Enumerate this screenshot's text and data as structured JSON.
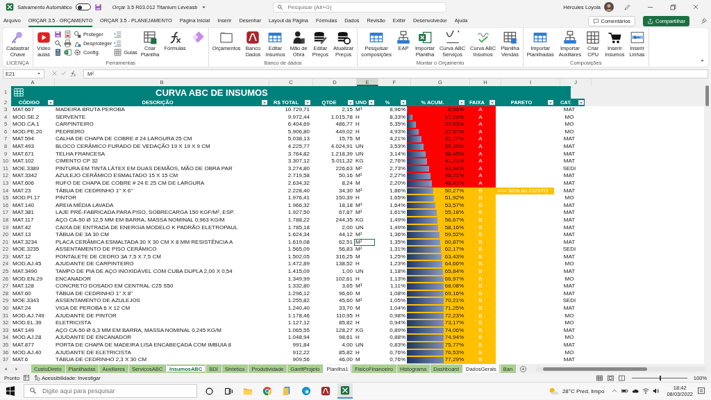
{
  "titlebar": {
    "autosave_label": "Salvamento Automático",
    "autosave": {
      "on": false
    },
    "filename": "Orçar 3.5 R03.012 Titanium Leveasb",
    "search": {
      "placeholder": "Pesquisar (Alt+G)"
    },
    "user": "Hércules Loyola"
  },
  "menu": {
    "tabs": [
      {
        "label": "Arquivo",
        "selected": false
      },
      {
        "label": "ORÇAR 3.5 - ORÇAMENTO",
        "selected": true
      },
      {
        "label": "ORÇAR 3.5 - PLANEJAMENTO",
        "selected": false
      },
      {
        "label": "Página Inicial",
        "selected": false
      },
      {
        "label": "Inserir",
        "selected": false
      },
      {
        "label": "Desenhar",
        "selected": false
      },
      {
        "label": "Layout da Página",
        "selected": false
      },
      {
        "label": "Fórmulas",
        "selected": false
      },
      {
        "label": "Dados",
        "selected": false
      },
      {
        "label": "Revisão",
        "selected": false
      },
      {
        "label": "Exibir",
        "selected": false
      },
      {
        "label": "Desenvolvedor",
        "selected": false
      },
      {
        "label": "Ajuda",
        "selected": false
      }
    ],
    "comments": "Comentários",
    "share": "Compartilhar"
  },
  "ribbon": {
    "groups": [
      {
        "label": "LICENÇA",
        "items": [
          {
            "kind": "large",
            "label": "Cadastrar\nChave"
          }
        ]
      },
      {
        "label": "Ferramentas",
        "items": [
          {
            "kind": "large",
            "label": "Vídeo\naulas"
          },
          {
            "kind": "column",
            "buttons": [
              {
                "kind": "icon"
              },
              {
                "kind": "icon"
              },
              {
                "kind": "icon"
              }
            ]
          },
          {
            "kind": "column",
            "buttons": [
              {
                "kind": "icon"
              },
              {
                "kind": "icon"
              },
              {
                "kind": "icon"
              }
            ]
          },
          {
            "kind": "column",
            "buttons": [
              {
                "kind": "small",
                "label": "Proteger"
              },
              {
                "kind": "small",
                "label": "Desproteger"
              },
              {
                "kind": "small",
                "label": "Config."
              }
            ]
          },
          {
            "kind": "column",
            "buttons": [
              {
                "kind": "icon"
              },
              {
                "kind": "icon"
              },
              {
                "kind": "small",
                "label": "Guias"
              }
            ]
          },
          {
            "kind": "large",
            "label": "Criar\nPlanilha"
          },
          {
            "kind": "large",
            "label": "Fórmulas"
          },
          {
            "kind": "large_icon"
          }
        ]
      },
      {
        "label": "Banco de dados",
        "items": [
          {
            "kind": "large",
            "label": "Orçamentos"
          },
          {
            "kind": "large",
            "label": "Banco\nDados"
          },
          {
            "kind": "large",
            "label": "Editar\nInsumos"
          },
          {
            "kind": "large",
            "label": "Mão de\nObra"
          },
          {
            "kind": "large",
            "label": "Editar\nPreços"
          },
          {
            "kind": "large",
            "label": "Atualizar\nPreços"
          }
        ]
      },
      {
        "label": "Montar o Orçamento",
        "items": [
          {
            "kind": "large",
            "label": "Pesquisar\ncomposições"
          },
          {
            "kind": "large",
            "label": "EAP"
          },
          {
            "kind": "large",
            "label": "Importar\nPlanilha"
          },
          {
            "kind": "large",
            "label": "Curva ABC\nServiços"
          },
          {
            "kind": "large",
            "label": "Curva ABC\nInsumos"
          },
          {
            "kind": "large",
            "label": "Planilha\nVendas"
          }
        ]
      },
      {
        "label": "Composições",
        "items": [
          {
            "kind": "large",
            "label": "Importar\nPlanilhadas"
          },
          {
            "kind": "large",
            "label": "Importar\nAuxiliares"
          },
          {
            "kind": "large",
            "label": "Criar\nCPU"
          },
          {
            "kind": "large",
            "label": "Inserir\nInsumos"
          },
          {
            "kind": "large",
            "label": "Inserir\nLinhas"
          }
        ]
      }
    ]
  },
  "formula_bar": {
    "name_box": "E21",
    "formula": "M²"
  },
  "sheet": {
    "title_row": "1",
    "header_row": "2",
    "columns": [
      "A",
      "B",
      "C",
      "D",
      "E",
      "F",
      "G",
      "H",
      "I",
      "J"
    ],
    "title": "CURVA ABC DE INSUMOS",
    "headers": [
      "CÓDIGO",
      "DESCRIÇÃO",
      "R$ TOTAL",
      "QTDE",
      "UND",
      "%",
      "% ACUM.",
      "FAIXA",
      "PARETO",
      "CAT."
    ],
    "rows": [
      {
        "n": "3",
        "code": "MAT.667",
        "desc": "MADEIRA BRUTA PEROBA",
        "total": "10.729,71",
        "qtde": "2,15",
        "und": "M³",
        "pct": "8,96%",
        "acum": "8,96%",
        "level": 0,
        "faixa": "A",
        "color": "#ff0000",
        "cat": "MAT",
        "selected": false
      },
      {
        "n": "4",
        "code": "MOD.SE.2",
        "desc": "SERVENTE",
        "total": "9.972,44",
        "qtde": "1.015,78",
        "und": "H",
        "pct": "8,33%",
        "acum": "17,29%",
        "level": 0.09,
        "faixa": "A",
        "color": "#ff0000",
        "cat": "MO",
        "selected": false
      },
      {
        "n": "5",
        "code": "MOD.CA.1",
        "desc": "CARPINTEIRO",
        "total": "6.404,69",
        "qtde": "486,77",
        "und": "H",
        "pct": "5,35%",
        "acum": "22,63%",
        "level": 0.15,
        "faixa": "A",
        "color": "#ff0000",
        "cat": "MO",
        "selected": false
      },
      {
        "n": "6",
        "code": "MOD.PE.20",
        "desc": "PEDREIRO",
        "total": "5.906,80",
        "qtde": "449,02",
        "und": "H",
        "pct": "4,93%",
        "acum": "27,57%",
        "level": 0.2,
        "faixa": "A",
        "color": "#ff0000",
        "cat": "MO",
        "selected": false
      },
      {
        "n": "7",
        "code": "MAT.594",
        "desc": "CALHA DE CHAPA DE COBRE # 24 LARGURA 25 CM",
        "total": "5.038,13",
        "qtde": "15,75",
        "und": "M",
        "pct": "4,21%",
        "acum": "31,77%",
        "level": 0.25,
        "faixa": "A",
        "color": "#ff0000",
        "cat": "MAT",
        "selected": false
      },
      {
        "n": "8",
        "code": "MAT.493",
        "desc": "BLOCO CERÂMICO FURADO DE VEDAÇÃO 19 X 19 X 9 CM",
        "total": "4.225,77",
        "qtde": "4.024,91",
        "und": "UN",
        "pct": "3,53%",
        "acum": "35,30%",
        "level": 0.29,
        "faixa": "A",
        "color": "#ff0000",
        "cat": "MAT",
        "selected": false
      },
      {
        "n": "9",
        "code": "MAT.671",
        "desc": "TELHA FRANCESA",
        "total": "3.764,82",
        "qtde": "1.218,39",
        "und": "UN",
        "pct": "3,14%",
        "acum": "38,45%",
        "level": 0.32,
        "faixa": "A",
        "color": "#ff0000",
        "cat": "MAT",
        "selected": false
      },
      {
        "n": "10",
        "code": "MAT.102",
        "desc": "CIMENTO CP 32",
        "total": "3.307,12",
        "qtde": "5.011,32",
        "und": "KG",
        "pct": "2,76%",
        "acum": "41,21%",
        "level": 0.35,
        "faixa": "A",
        "color": "#ff0000",
        "cat": "MAT",
        "selected": false
      },
      {
        "n": "11",
        "code": "MOE.3389",
        "desc": "PINTURA EM TINTA LÁTEX EM DUAS DEMÃOS, MÃO DE OBRA PAR",
        "total": "3.274,80",
        "qtde": "226,63",
        "und": "M²",
        "pct": "2,73%",
        "acum": "43,94%",
        "level": 0.38,
        "faixa": "A",
        "color": "#ff0000",
        "cat": "SEDI",
        "selected": false
      },
      {
        "n": "12",
        "code": "MAT.3342",
        "desc": "AZULEJO CERÂMICO ESMALTADO 15 X 15 CM",
        "total": "2.719,58",
        "qtde": "50,16",
        "und": "M²",
        "pct": "2,27%",
        "acum": "46,21%",
        "level": 0.41,
        "faixa": "A",
        "color": "#ff0000",
        "cat": "MAT",
        "selected": false
      },
      {
        "n": "13",
        "code": "MAT.606",
        "desc": "RUFO DE CHAPA DE COBRE # 24 E 25 CM DE LARGURA",
        "total": "2.634,32",
        "qtde": "8,24",
        "und": "M",
        "pct": "2,20%",
        "acum": "48,41%",
        "level": 0.43,
        "faixa": "A",
        "color": "#ff0000",
        "cat": "MAT",
        "selected": false
      },
      {
        "n": "14",
        "code": "MAT.23",
        "desc": "TÁBUA DE CEDRINHO 1\" X 6\"",
        "total": "2.228,40",
        "qtde": "34,30",
        "und": "M²",
        "pct": "1,86%",
        "acum": "50,27%",
        "level": 0.45,
        "faixa": "B",
        "color": "#ffc000",
        "pareto": "<== 50% do CUSTO",
        "cat": "MAT",
        "selected": false
      },
      {
        "n": "15",
        "code": "MOD.PI.17",
        "desc": "PINTOR",
        "total": "1.976,41",
        "qtde": "150,39",
        "und": "H",
        "pct": "1,65%",
        "acum": "51,92%",
        "level": 0.47,
        "faixa": "B",
        "color": "#ffc000",
        "cat": "MO",
        "selected": false
      },
      {
        "n": "16",
        "code": "MAT.140",
        "desc": "AREIA MÉDIA LAVADA",
        "total": "1.966,32",
        "qtde": "18,18",
        "und": "M³",
        "pct": "1,64%",
        "acum": "53,57%",
        "level": 0.49,
        "faixa": "B",
        "color": "#ffc000",
        "cat": "MAT",
        "selected": false
      },
      {
        "n": "17",
        "code": "MAT.381",
        "desc": "LAJE PRÉ-FABRICADA PARA PISO, SOBRECARGA 150 KGF/M², ESP.",
        "total": "1.927,50",
        "qtde": "67,87",
        "und": "M²",
        "pct": "1,61%",
        "acum": "55,18%",
        "level": 0.51,
        "faixa": "B",
        "color": "#ffc000",
        "cat": "MAT",
        "selected": false
      },
      {
        "n": "18",
        "code": "MAT.117",
        "desc": "AÇO CA-50 Ø 12,5 MM EM BARRA, MASSA NOMINAL 0,963 KG/M",
        "total": "1.788,22",
        "qtde": "244,35",
        "und": "KG",
        "pct": "1,49%",
        "acum": "56,67%",
        "level": 0.52,
        "faixa": "B",
        "color": "#ffc000",
        "cat": "MAT",
        "selected": false
      },
      {
        "n": "19",
        "code": "MAT.42",
        "desc": "CAIXA DE ENTRADA DE ENERGIA MODELO K PADRÃO ELETROPAUL",
        "total": "1.785,18",
        "qtde": "2,00",
        "und": "UN",
        "pct": "1,49%",
        "acum": "58,16%",
        "level": 0.54,
        "faixa": "B",
        "color": "#ffc000",
        "cat": "MAT",
        "selected": false
      },
      {
        "n": "20",
        "code": "MAT.13",
        "desc": "TÁBUA DE 3A 30 CM",
        "total": "1.624,34",
        "qtde": "44,12",
        "und": "M²",
        "pct": "1,36%",
        "acum": "59,52%",
        "level": 0.555,
        "faixa": "B",
        "color": "#ffc000",
        "cat": "MAT",
        "selected": false
      },
      {
        "n": "21",
        "code": "MAT.3234",
        "desc": "PLACA CERÂMICA ESMALTADA 30 X 30 CM X 8 MM RESISTÊNCIA A",
        "total": "1.619,08",
        "qtde": "62,51",
        "und": "M²",
        "pct": "1,35%",
        "acum": "60,87%",
        "level": 0.57,
        "faixa": "B",
        "color": "#ffc000",
        "cat": "MAT",
        "selected": true
      },
      {
        "n": "22",
        "code": "MOE.3235",
        "desc": "ASSENTAMENTO DE PISO CERÂMICO",
        "total": "1.565,09",
        "qtde": "56,83",
        "und": "M²",
        "pct": "1,31%",
        "acum": "62,17%",
        "level": 0.58,
        "faixa": "B",
        "color": "#ffc000",
        "cat": "SEDI",
        "selected": false
      },
      {
        "n": "23",
        "code": "MAT.12",
        "desc": "PONTALETE DE CEDRO 3A 7,5 X 7,5 CM",
        "total": "1.502,05",
        "qtde": "316,25",
        "und": "M",
        "pct": "1,25%",
        "acum": "63,43%",
        "level": 0.6,
        "faixa": "B",
        "color": "#ffc000",
        "cat": "MAT",
        "selected": false
      },
      {
        "n": "24",
        "code": "MOD.AJ.45",
        "desc": "AJUDANTE DE CARPINTEIRO",
        "total": "1.472,89",
        "qtde": "138,52",
        "und": "H",
        "pct": "1,23%",
        "acum": "64,66%",
        "level": 0.61,
        "faixa": "B",
        "color": "#ffc000",
        "cat": "MO",
        "selected": false
      },
      {
        "n": "25",
        "code": "MAT.3490",
        "desc": "TAMPO DE PIA DE AÇO INOXIDÁVEL COM CUBA DUPLA 2,00 X 0,54",
        "total": "1.415,09",
        "qtde": "1,00",
        "und": "UN",
        "pct": "1,18%",
        "acum": "65,84%",
        "level": 0.62,
        "faixa": "B",
        "color": "#ffc000",
        "cat": "MAT",
        "selected": false
      },
      {
        "n": "26",
        "code": "MOD.EN.29",
        "desc": "ENCANADOR",
        "total": "1.349,99",
        "qtde": "102,61",
        "und": "H",
        "pct": "1,13%",
        "acum": "66,97%",
        "level": 0.64,
        "faixa": "B",
        "color": "#ffc000",
        "cat": "MO",
        "selected": false
      },
      {
        "n": "27",
        "code": "MAT.128",
        "desc": "CONCRETO DOSADO EM CENTRAL C25 S50",
        "total": "1.332,80",
        "qtde": "3,65",
        "und": "M³",
        "pct": "1,11%",
        "acum": "68,08%",
        "level": 0.65,
        "faixa": "B",
        "color": "#ffc000",
        "cat": "MAT",
        "selected": false
      },
      {
        "n": "28",
        "code": "MAT.60",
        "desc": "TÁBUA DE CEDRINHO 1\" X 8\"",
        "total": "1.296,12",
        "qtde": "96,60",
        "und": "M",
        "pct": "1,08%",
        "acum": "69,16%",
        "level": 0.66,
        "faixa": "B",
        "color": "#ffc000",
        "cat": "MAT",
        "selected": false
      },
      {
        "n": "29",
        "code": "MOE.3343",
        "desc": "ASSENTAMENTO DE AZULEJOS",
        "total": "1.255,82",
        "qtde": "45,60",
        "und": "M²",
        "pct": "1,05%",
        "acum": "70,21%",
        "level": 0.67,
        "faixa": "B",
        "color": "#ffc000",
        "cat": "SEDI",
        "selected": false
      },
      {
        "n": "30",
        "code": "MAT.24",
        "desc": "VIGA DE PEROBA 6 X 12 CM",
        "total": "1.240,40",
        "qtde": "33,70",
        "und": "M",
        "pct": "1,04%",
        "acum": "71,25%",
        "level": 0.68,
        "faixa": "B",
        "color": "#ffc000",
        "cat": "MAT",
        "selected": false
      },
      {
        "n": "31",
        "code": "MOD.AJ.749",
        "desc": "AJUDANTE DE PINTOR",
        "total": "1.178,46",
        "qtde": "110,95",
        "und": "H",
        "pct": "0,98%",
        "acum": "72,23%",
        "level": 0.69,
        "faixa": "B",
        "color": "#ffc000",
        "cat": "MO",
        "selected": false
      },
      {
        "n": "32",
        "code": "MOD.EL.39",
        "desc": "ELETRICISTA",
        "total": "1.127,12",
        "qtde": "85,82",
        "und": "H",
        "pct": "0,94%",
        "acum": "73,17%",
        "level": 0.705,
        "faixa": "B",
        "color": "#ffc000",
        "cat": "MO",
        "selected": false
      },
      {
        "n": "33",
        "code": "MAT.149",
        "desc": "AÇO CA-50 Ø 6,3 MM EM BARRA, MASSA NOMINAL 0,245 KG/M",
        "total": "1.065,55",
        "qtde": "128,27",
        "und": "KG",
        "pct": "0,89%",
        "acum": "74,06%",
        "level": 0.715,
        "faixa": "B",
        "color": "#ffc000",
        "cat": "MAT",
        "selected": false
      },
      {
        "n": "34",
        "code": "MOD.AJ.28",
        "desc": "AJUDANTE DE ENCANADOR",
        "total": "1.048,94",
        "qtde": "98,61",
        "und": "H",
        "pct": "0,88%",
        "acum": "74,94%",
        "level": 0.725,
        "faixa": "B",
        "color": "#ffc000",
        "cat": "MO",
        "selected": false
      },
      {
        "n": "35",
        "code": "MAT.877",
        "desc": "PORTA DE CHAPA DE MADEIRA LISA ENCABEÇADA COM IMBUIA 8",
        "total": "991,84",
        "qtde": "4,00",
        "und": "UN",
        "pct": "0,83%",
        "acum": "75,77%",
        "level": 0.73,
        "faixa": "B",
        "color": "#ffc000",
        "cat": "MAT",
        "selected": false
      },
      {
        "n": "36",
        "code": "MOD.AJ.40",
        "desc": "AJUDANTE DE ELETRICISTA",
        "total": "912,22",
        "qtde": "85,82",
        "und": "H",
        "pct": "0,76%",
        "acum": "76,53%",
        "level": 0.74,
        "faixa": "B",
        "color": "#ffc000",
        "cat": "MO",
        "selected": false
      },
      {
        "n": "37",
        "code": "MAT.6",
        "desc": "TÁBUA DE CEDRINHO 2,3 X 30 CM",
        "total": "909,56",
        "qtde": "46,00",
        "und": "M",
        "pct": "0,76%",
        "acum": "77,29%",
        "level": 0.75,
        "faixa": "B",
        "color": "#ffc000",
        "cat": "MAT",
        "selected": false
      }
    ]
  },
  "sheet_tabs": [
    {
      "label": "CustoDireto",
      "selected": false,
      "color": "#a9d08e"
    },
    {
      "label": "Planilhadas",
      "selected": false,
      "color": "#a9d08e"
    },
    {
      "label": "Auxiliares",
      "selected": false,
      "color": "#a9d08e"
    },
    {
      "label": "ServicosABC",
      "selected": false,
      "color": "#a9d08e"
    },
    {
      "label": "InsumosABC",
      "selected": true,
      "color": "#a9d08e"
    },
    {
      "label": "BDI",
      "selected": false,
      "color": "#a9d08e"
    },
    {
      "label": "Sintetico",
      "selected": false,
      "color": "#a9d08e"
    },
    {
      "label": "Produtividade",
      "selected": false,
      "color": "#a9d08e"
    },
    {
      "label": "GanttProjeto",
      "selected": false,
      "color": "#a9d08e"
    },
    {
      "label": "Planilha1",
      "selected": false
    },
    {
      "label": "FisicoFinanceiro",
      "selected": false,
      "color": "#a9d08e"
    },
    {
      "label": "Histograma",
      "selected": false,
      "color": "#a9d08e"
    },
    {
      "label": "Dashboard",
      "selected": false,
      "color": "#a9d08e"
    },
    {
      "label": "DadosGerais",
      "selected": false
    },
    {
      "label": "Ban",
      "selected": false,
      "color": "#a9d08e"
    }
  ],
  "status_bar": {
    "mode": "Pronto",
    "accessibility": "Acessibilidade: Investigar",
    "zoom": {
      "level": 0.5
    },
    "zoom_label": "100%"
  },
  "taskbar": {
    "search": {
      "placeholder": "Digite aqui para pesquisar"
    },
    "weather": "28°C  Pred. limpo",
    "time": "18:42",
    "date": "08/03/2022"
  }
}
